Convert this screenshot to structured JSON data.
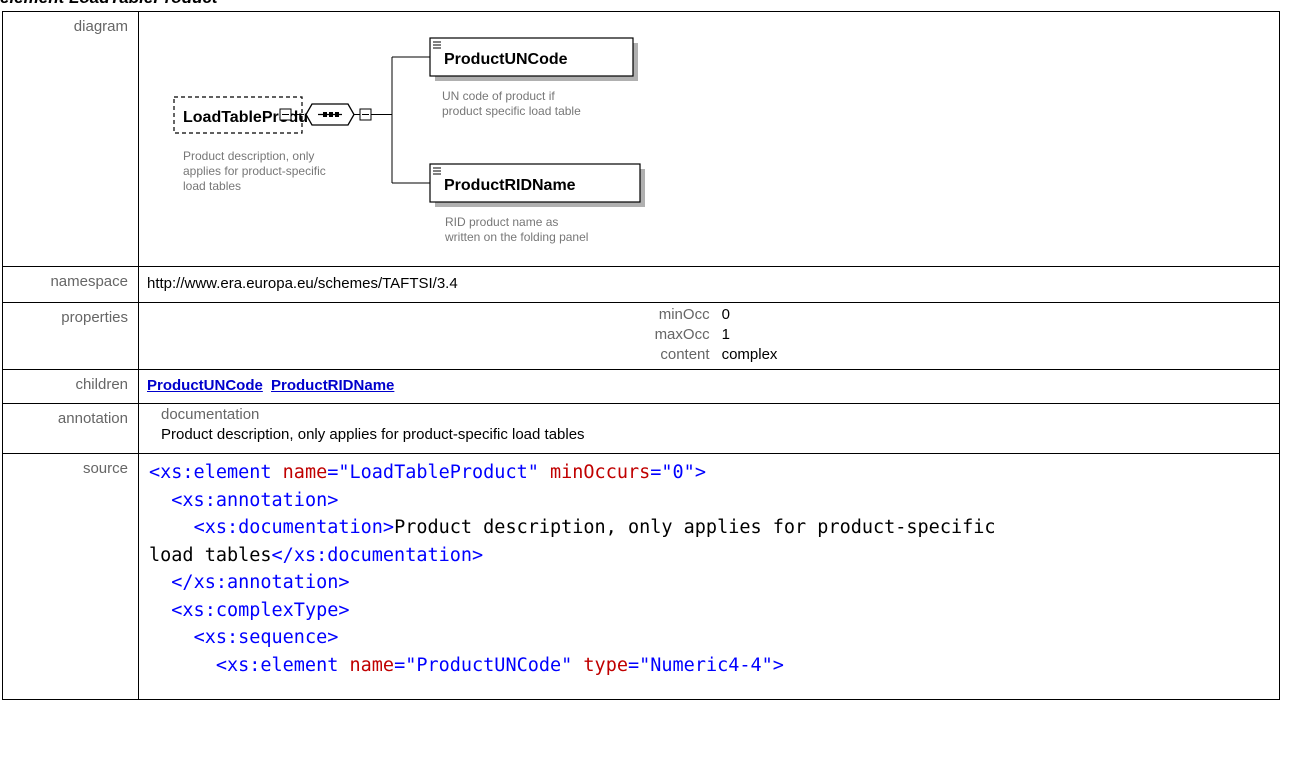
{
  "page_title": "element LoadTableProduct",
  "rows": {
    "diagram_label": "diagram",
    "namespace_label": "namespace",
    "namespace_value": "http://www.era.europa.eu/schemes/TAFTSI/3.4",
    "properties_label": "properties",
    "properties": [
      {
        "key": "minOcc",
        "value": "0"
      },
      {
        "key": "maxOcc",
        "value": "1"
      },
      {
        "key": "content",
        "value": "complex"
      }
    ],
    "children_label": "children",
    "children": [
      "ProductUNCode",
      "ProductRIDName"
    ],
    "annotation_label": "annotation",
    "annotation_sub": "documentation",
    "annotation_text": "Product description, only applies for product-specific load tables",
    "source_label": "source"
  },
  "diagram": {
    "root_name": "LoadTableProduct",
    "root_doc": [
      "Product description, only",
      "applies for product-specific",
      "load tables"
    ],
    "child1_name": "ProductUNCode",
    "child1_doc": [
      "UN code of product if",
      "product specific load table"
    ],
    "child2_name": "ProductRIDName",
    "child2_doc": [
      "RID product name as",
      "written on the folding panel"
    ]
  },
  "source": {
    "l1_tag": "xs:element",
    "l1_attr1": "name",
    "l1_val1": "\"LoadTableProduct\"",
    "l1_attr2": "minOccurs",
    "l1_val2": "\"0\"",
    "l2": "xs:annotation",
    "l3_tag": "xs:documentation",
    "l3_text_a": "Product description, only applies for product-specific",
    "l3_text_b": "load tables",
    "l3_close": "xs:documentation",
    "l4": "xs:annotation",
    "l5": "xs:complexType",
    "l6": "xs:sequence",
    "l7_tag": "xs:element",
    "l7_attr1": "name",
    "l7_val1": "\"ProductUNCode\"",
    "l7_attr2": "type",
    "l7_val2": "\"Numeric4-4\""
  }
}
